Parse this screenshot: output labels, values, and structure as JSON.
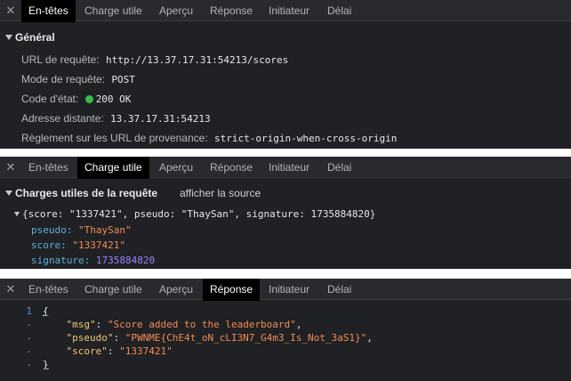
{
  "tabs": [
    "En-têtes",
    "Charge utile",
    "Aperçu",
    "Réponse",
    "Initiateur",
    "Délai"
  ],
  "close_glyph": "✕",
  "general": {
    "title": "Général",
    "rows": [
      {
        "label": "URL de requête:",
        "value": "http://13.37.17.31:54213/scores"
      },
      {
        "label": "Mode de requête:",
        "value": "POST"
      },
      {
        "label": "Code d'état:",
        "value": "200 OK"
      },
      {
        "label": "Adresse distante:",
        "value": "13.37.17.31:54213"
      },
      {
        "label": "Règlement sur les URL de provenance:",
        "value": "strict-origin-when-cross-origin"
      }
    ],
    "status_color": "#2fbf4a"
  },
  "payload": {
    "title": "Charges utiles de la requête",
    "view_source": "afficher la source",
    "summary": "{score: \"1337421\", pseudo: \"ThaySan\", signature: 1735884820}",
    "props": [
      {
        "key": "pseudo",
        "value": "\"ThaySan\"",
        "kind": "str"
      },
      {
        "key": "score",
        "value": "\"1337421\"",
        "kind": "str"
      },
      {
        "key": "signature",
        "value": "1735884820",
        "kind": "num"
      }
    ]
  },
  "response": {
    "line_numbers": [
      "1",
      "-",
      "-",
      "-",
      "-"
    ],
    "open_brace": "{",
    "close_brace": "}",
    "entries": [
      {
        "key": "\"msg\"",
        "value": "\"Score added to the leaderboard\"",
        "comma": ","
      },
      {
        "key": "\"pseudo\"",
        "value": "\"PWNME{ChE4t_oN_cLI3N7_G4m3_Is_Not_3aS1}\"",
        "comma": ","
      },
      {
        "key": "\"score\"",
        "value": "\"1337421\"",
        "comma": ""
      }
    ]
  },
  "colors": {
    "panel_bg": "#202124",
    "tab_active_bg": "#000000",
    "key_blue": "#5db0d7",
    "string_orange": "#f28b54",
    "number_purple": "#9980ff",
    "json_key_yellow": "#f0c674"
  }
}
